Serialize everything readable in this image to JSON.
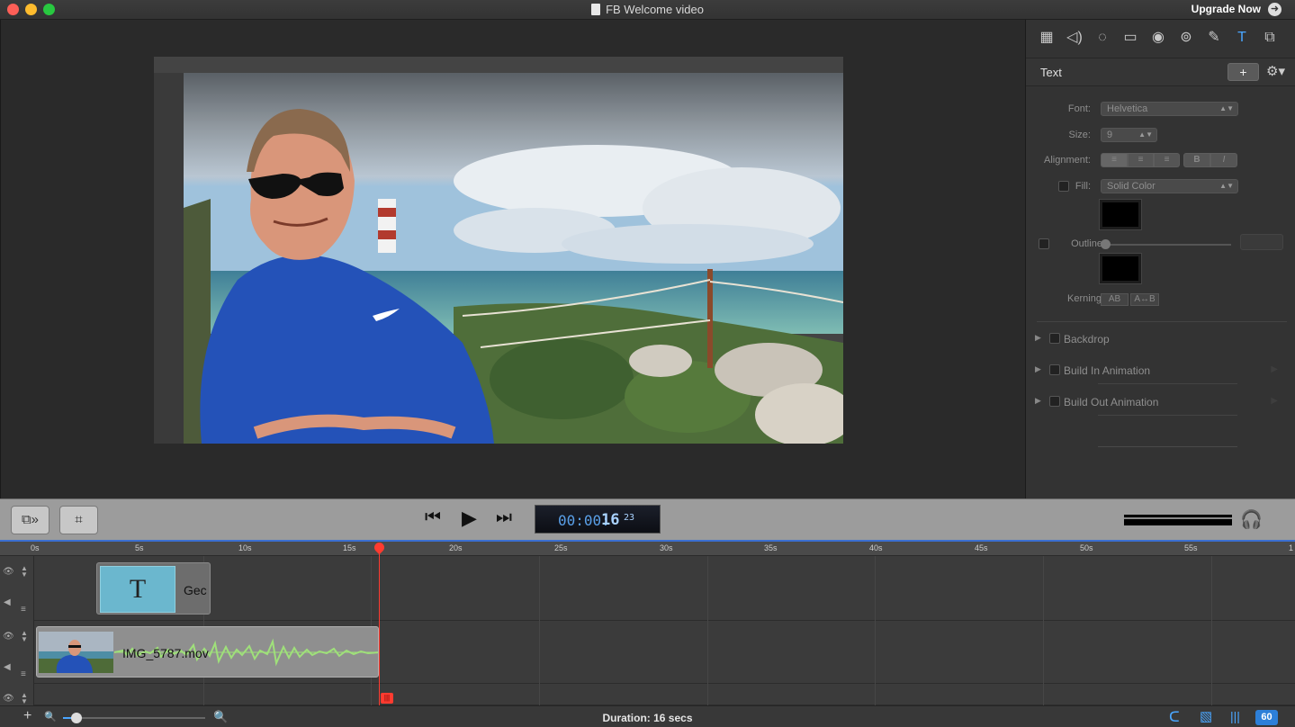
{
  "window": {
    "title": "FB Welcome video",
    "upgrade_label": "Upgrade Now"
  },
  "inspector": {
    "tabs": [
      {
        "icon": "film-icon",
        "glyph": "▦"
      },
      {
        "icon": "speaker-icon",
        "glyph": "◁)"
      },
      {
        "icon": "rotate-icon",
        "glyph": "◌"
      },
      {
        "icon": "screen-icon",
        "glyph": "▭"
      },
      {
        "icon": "cursor-icon",
        "glyph": "◉"
      },
      {
        "icon": "effects-icon",
        "glyph": "⊚"
      },
      {
        "icon": "pen-icon",
        "glyph": "✎"
      },
      {
        "icon": "text-icon",
        "glyph": "T"
      },
      {
        "icon": "layers-icon",
        "glyph": "⧉"
      }
    ],
    "title": "Text",
    "add_label": "+",
    "font_label": "Font:",
    "font_value": "Helvetica",
    "size_label": "Size:",
    "size_value": "9",
    "alignment_label": "Alignment:",
    "bold_label": "B",
    "italic_label": "I",
    "fill_label": "Fill:",
    "fill_value": "Solid Color",
    "outline_label": "Outline:",
    "kerning_label": "Kerning:",
    "kern_tight": "AB",
    "kern_loose": "A↔B",
    "sections": [
      "Backdrop",
      "Build In Animation",
      "Build Out Animation"
    ],
    "fill_color": "#000000",
    "outline_color": "#000000"
  },
  "transport": {
    "timecode_dim": "00:00:",
    "timecode_seconds": "16",
    "timecode_frames": "23"
  },
  "timeline": {
    "ruler_labels": [
      "0s",
      "5s",
      "10s",
      "15s",
      "20s",
      "25s",
      "30s",
      "35s",
      "40s",
      "45s",
      "50s",
      "55s",
      "1"
    ],
    "text_clip_label": "Gec",
    "text_clip_glyph": "T",
    "video_clip_label": "IMG_5787.mov",
    "playhead_color": "#ff3b30"
  },
  "status": {
    "duration": "Duration: 16 secs",
    "fps": "60"
  },
  "colors": {
    "accent": "#4aa6ff",
    "waveform": "#9fe07a",
    "text_clip": "#6bb7ce"
  }
}
